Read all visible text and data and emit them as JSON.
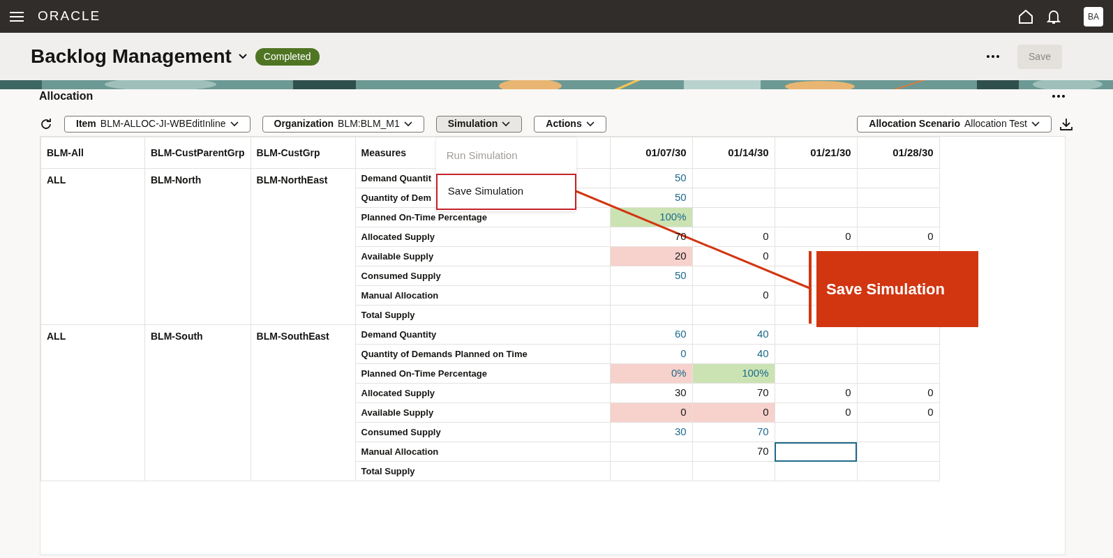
{
  "topbar": {
    "logo": "ORACLE",
    "avatar": "BA"
  },
  "header": {
    "title": "Backlog Management",
    "status": "Completed",
    "save_button": {
      "label": "Save",
      "disabled": true
    }
  },
  "section": {
    "title": "Allocation"
  },
  "toolbar": {
    "filters": [
      {
        "label": "Item",
        "value": "BLM-ALLOC-JI-WBEditInline",
        "expanded": false
      },
      {
        "label": "Organization",
        "value": "BLM:BLM_M1",
        "expanded": false
      },
      {
        "label": "Simulation",
        "expanded": true
      },
      {
        "label": "Actions",
        "expanded": false
      }
    ],
    "scenario": {
      "label": "Allocation Scenario",
      "value": "Allocation Test",
      "expanded": false
    }
  },
  "menu": {
    "items": [
      {
        "label": "Run Simulation",
        "disabled": true,
        "selected": false
      },
      {
        "label": "Save Simulation",
        "disabled": false,
        "selected": true
      }
    ]
  },
  "table": {
    "columns": [
      "BLM-All",
      "BLM-CustParentGrp",
      "BLM-CustGrp",
      "Measures",
      "01/07/30",
      "01/14/30",
      "01/21/30",
      "01/28/30"
    ],
    "groups": [
      {
        "all": "ALL",
        "parent": "BLM-North",
        "group": "BLM-NorthEast",
        "rows": [
          {
            "measure": "Demand Quantit",
            "cells": [
              {
                "value": "50",
                "kind": "link"
              },
              {
                "kind": "empty"
              },
              {
                "kind": "empty"
              },
              {
                "kind": "empty"
              }
            ]
          },
          {
            "measure": "Quantity of Dem",
            "cells": [
              {
                "value": "50",
                "kind": "link"
              },
              {
                "kind": "empty"
              },
              {
                "kind": "empty"
              },
              {
                "kind": "empty"
              }
            ]
          },
          {
            "measure": "Planned On-Time Percentage",
            "cells": [
              {
                "value": "100%",
                "kind": "link",
                "color": "#cbe3b3"
              },
              {
                "kind": "empty"
              },
              {
                "kind": "empty"
              },
              {
                "kind": "empty"
              }
            ]
          },
          {
            "measure": "Allocated Supply",
            "cells": [
              {
                "value": "70",
                "kind": "plain"
              },
              {
                "value": "0",
                "kind": "plain"
              },
              {
                "value": "0",
                "kind": "plain"
              },
              {
                "value": "0",
                "kind": "plain"
              }
            ]
          },
          {
            "measure": "Available Supply",
            "cells": [
              {
                "value": "20",
                "kind": "plain",
                "color": "#f7d1cc"
              },
              {
                "value": "0",
                "kind": "plain"
              },
              {
                "kind": "empty"
              },
              {
                "kind": "empty"
              }
            ]
          },
          {
            "measure": "Consumed Supply",
            "cells": [
              {
                "value": "50",
                "kind": "link"
              },
              {
                "kind": "empty"
              },
              {
                "kind": "empty"
              },
              {
                "kind": "empty"
              }
            ]
          },
          {
            "measure": "Manual Allocation",
            "cells": [
              {
                "kind": "empty"
              },
              {
                "value": "0",
                "kind": "plain"
              },
              {
                "kind": "empty"
              },
              {
                "kind": "empty"
              }
            ]
          },
          {
            "measure": "Total Supply",
            "cells": [
              {
                "kind": "empty"
              },
              {
                "kind": "empty"
              },
              {
                "kind": "empty"
              },
              {
                "kind": "empty"
              }
            ]
          }
        ]
      },
      {
        "all": "ALL",
        "parent": "BLM-South",
        "group": "BLM-SouthEast",
        "rows": [
          {
            "measure": "Demand Quantity",
            "cells": [
              {
                "value": "60",
                "kind": "link"
              },
              {
                "value": "40",
                "kind": "link"
              },
              {
                "kind": "empty"
              },
              {
                "kind": "empty"
              }
            ]
          },
          {
            "measure": "Quantity of Demands Planned on Time",
            "cells": [
              {
                "value": "0",
                "kind": "link"
              },
              {
                "value": "40",
                "kind": "link"
              },
              {
                "kind": "empty"
              },
              {
                "kind": "empty"
              }
            ]
          },
          {
            "measure": "Planned On-Time Percentage",
            "cells": [
              {
                "value": "0%",
                "kind": "link",
                "color": "#f7d1cc"
              },
              {
                "value": "100%",
                "kind": "link",
                "color": "#cbe3b3"
              },
              {
                "kind": "empty"
              },
              {
                "kind": "empty"
              }
            ]
          },
          {
            "measure": "Allocated Supply",
            "cells": [
              {
                "value": "30",
                "kind": "plain"
              },
              {
                "value": "70",
                "kind": "plain"
              },
              {
                "value": "0",
                "kind": "plain"
              },
              {
                "value": "0",
                "kind": "plain"
              }
            ]
          },
          {
            "measure": "Available Supply",
            "cells": [
              {
                "value": "0",
                "kind": "plain",
                "color": "#f7d1cc"
              },
              {
                "value": "0",
                "kind": "plain",
                "color": "#f7d1cc"
              },
              {
                "value": "0",
                "kind": "plain"
              },
              {
                "value": "0",
                "kind": "plain"
              }
            ]
          },
          {
            "measure": "Consumed Supply",
            "cells": [
              {
                "value": "30",
                "kind": "link"
              },
              {
                "value": "70",
                "kind": "link"
              },
              {
                "kind": "empty"
              },
              {
                "kind": "empty"
              }
            ]
          },
          {
            "measure": "Manual Allocation",
            "cells": [
              {
                "kind": "empty"
              },
              {
                "value": "70",
                "kind": "plain"
              },
              {
                "kind": "input"
              },
              {
                "kind": "empty"
              }
            ]
          },
          {
            "measure": "Total Supply",
            "cells": [
              {
                "kind": "empty"
              },
              {
                "kind": "empty"
              },
              {
                "kind": "empty"
              },
              {
                "kind": "empty"
              }
            ]
          }
        ]
      }
    ]
  },
  "callout": {
    "text": "Save Simulation"
  }
}
